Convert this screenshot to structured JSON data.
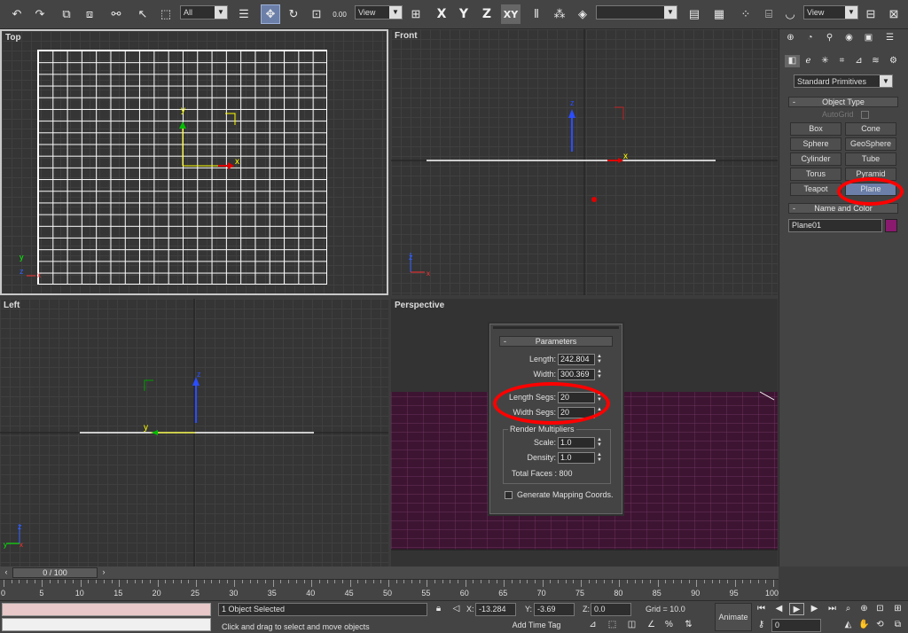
{
  "toolbar": {
    "selection_filter": "All",
    "ref_coord": "View",
    "snap_value": "0.00",
    "named_sel": "",
    "view_dropdown": "View",
    "axis_x": "X",
    "axis_y": "Y",
    "axis_z": "Z",
    "axis_xy": "XY"
  },
  "viewports": {
    "top": {
      "label": "Top",
      "axis_y": "y",
      "axis_x": "x"
    },
    "front": {
      "label": "Front",
      "axis_z": "z",
      "axis_x": "x"
    },
    "left": {
      "label": "Left",
      "axis_z": "z",
      "axis_y": "y"
    },
    "perspective": {
      "label": "Perspective"
    }
  },
  "command_panel": {
    "category": "Standard Primitives",
    "object_type_title": "Object Type",
    "autogrid": "AutoGrid",
    "buttons": [
      "Box",
      "Cone",
      "Sphere",
      "GeoSphere",
      "Cylinder",
      "Tube",
      "Torus",
      "Pyramid",
      "Teapot",
      "Plane"
    ],
    "name_color_title": "Name and Color",
    "object_name": "Plane01",
    "object_color": "#8a1a6e"
  },
  "parameters": {
    "title": "Parameters",
    "length_label": "Length:",
    "length": "242.804",
    "width_label": "Width:",
    "width": "300.369",
    "length_segs_label": "Length Segs:",
    "length_segs": "20",
    "width_segs_label": "Width Segs:",
    "width_segs": "20",
    "render_mult_title": "Render Multipliers",
    "scale_label": "Scale:",
    "scale": "1.0",
    "density_label": "Density:",
    "density": "1.0",
    "total_faces": "Total Faces : 800",
    "gen_mapping": "Generate Mapping Coords."
  },
  "timeline": {
    "frame": "0 / 100",
    "ticks": [
      "0",
      "5",
      "10",
      "15",
      "20",
      "25",
      "30",
      "35",
      "40",
      "45",
      "50",
      "55",
      "60",
      "65",
      "70",
      "75",
      "80",
      "85",
      "90",
      "95",
      "100"
    ]
  },
  "status": {
    "selected": "1 Object Selected",
    "prompt": "Click and drag to select and move objects",
    "x_label": "X:",
    "x": "-13.284",
    "y_label": "Y:",
    "y": "-3.69",
    "z_label": "Z:",
    "z": "0.0",
    "grid": "Grid = 10.0",
    "add_time_tag": "Add Time Tag",
    "animate": "Animate",
    "frame_field": "0"
  },
  "colors": {
    "accent_highlight": "#ff0000",
    "perspective_plane": "#3d1532"
  }
}
